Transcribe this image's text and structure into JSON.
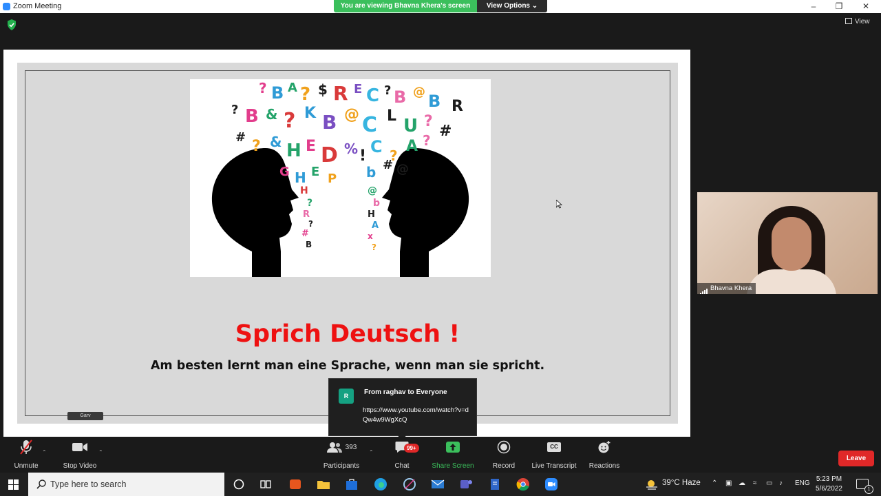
{
  "window": {
    "title": "Zoom Meeting"
  },
  "share_banner": {
    "text": "You are viewing Bhavna Khera's screen",
    "view_options": "View Options"
  },
  "view_button": {
    "label": "View"
  },
  "slide": {
    "title": "Sprich Deutsch !",
    "subtitle": "Am besten lernt man eine Sprache, wenn man sie spricht."
  },
  "name_tag": "Garv",
  "chat_popup": {
    "avatar_letter": "R",
    "from": "From raghav to Everyone",
    "message": "https://www.youtube.com/watch?v=dQw4w9WgXcQ"
  },
  "video_tile": {
    "name": "Bhavna Khera"
  },
  "toolbar": {
    "unmute": "Unmute",
    "stop_video": "Stop Video",
    "participants": "Participants",
    "participant_count": "393",
    "chat": "Chat",
    "chat_badge": "99+",
    "share_screen": "Share Screen",
    "record": "Record",
    "live_transcript": "Live Transcript",
    "cc": "CC",
    "reactions": "Reactions",
    "leave": "Leave"
  },
  "taskbar": {
    "search_placeholder": "Type here to search",
    "weather": "39°C  Haze",
    "language": "ENG",
    "time": "5:23 PM",
    "date": "5/6/2022",
    "notifications": "1"
  },
  "colors": {
    "share_green": "#3bbf5c",
    "slide_title_red": "#ee1111",
    "leave_red": "#e02828",
    "chat_avatar": "#15a182"
  }
}
